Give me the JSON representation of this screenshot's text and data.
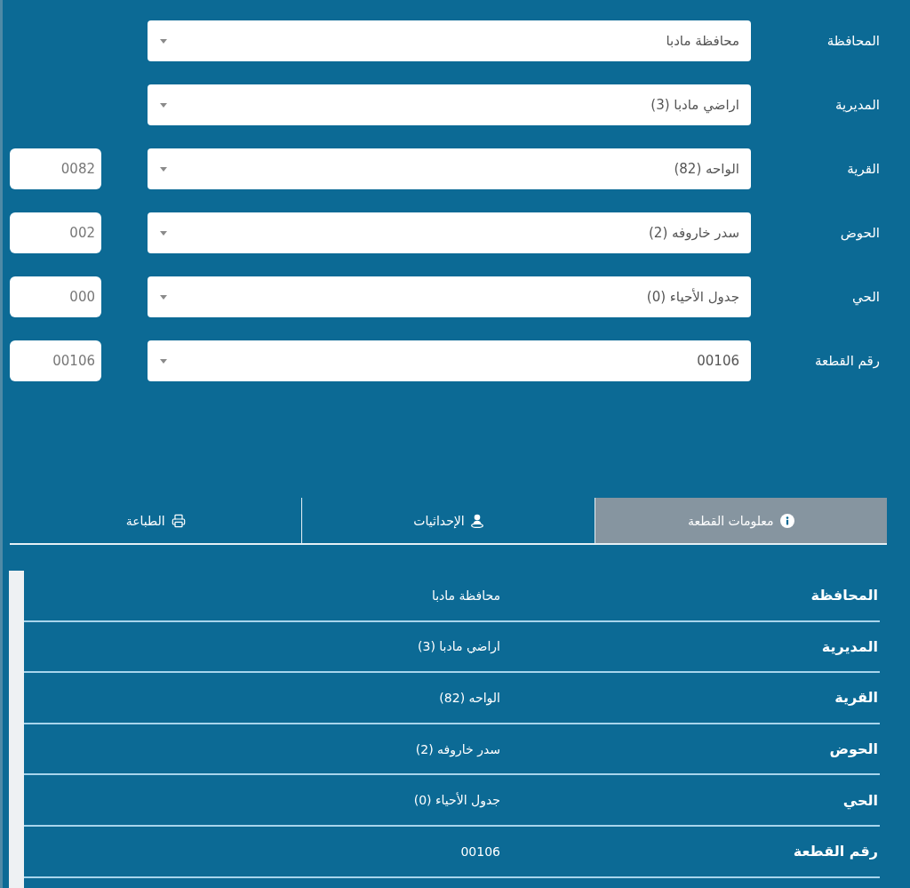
{
  "form": {
    "fields": [
      {
        "label": "المحافظة",
        "value": "محافظة مادبا"
      },
      {
        "label": "المديرية",
        "value": "اراضي مادبا (3)"
      },
      {
        "label": "القرية",
        "value": "الواحه (82)",
        "code": "0082"
      },
      {
        "label": "الحوض",
        "value": "سدر خاروفه (2)",
        "code": "002"
      },
      {
        "label": "الحي",
        "value": "جدول الأحياء (0)",
        "code": "000"
      },
      {
        "label": "رقم القطعة",
        "value": "00106",
        "code": "00106"
      }
    ]
  },
  "tabs": [
    {
      "label": "معلومات القطعة",
      "kind": "info",
      "selected": true
    },
    {
      "label": "الإحداثيات",
      "kind": "coordinates",
      "selected": false
    },
    {
      "label": "الطباعة",
      "kind": "print",
      "selected": false
    }
  ],
  "details": {
    "rows": [
      {
        "label": "المحافظة",
        "value": "محافظة مادبا"
      },
      {
        "label": "المديرية",
        "value": "اراضي مادبا (3)"
      },
      {
        "label": "القرية",
        "value": "الواحه (82)"
      },
      {
        "label": "الحوض",
        "value": "سدر خاروفه (2)"
      },
      {
        "label": "الحي",
        "value": "جدول الأحياء (0)"
      },
      {
        "label": "رقم القطعة",
        "value": "00106"
      }
    ]
  }
}
